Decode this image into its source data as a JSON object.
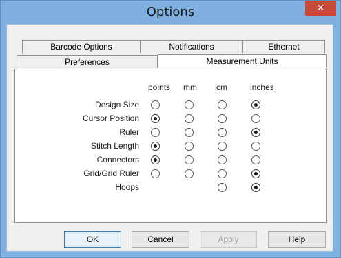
{
  "window": {
    "title": "Options",
    "close_glyph": "✕"
  },
  "tabs_back": [
    {
      "label": "Barcode Options"
    },
    {
      "label": "Notifications"
    },
    {
      "label": "Ethernet"
    }
  ],
  "tabs_front": [
    {
      "label": "Preferences"
    },
    {
      "label": "Measurement Units"
    }
  ],
  "columns": [
    {
      "label": "points"
    },
    {
      "label": "mm"
    },
    {
      "label": "cm"
    },
    {
      "label": "inches"
    }
  ],
  "rows": [
    {
      "label": "Design Size",
      "selected": "inches",
      "available": [
        "points",
        "mm",
        "cm",
        "inches"
      ]
    },
    {
      "label": "Cursor Position",
      "selected": "points",
      "available": [
        "points",
        "mm",
        "cm",
        "inches"
      ]
    },
    {
      "label": "Ruler",
      "selected": "inches",
      "available": [
        "points",
        "mm",
        "cm",
        "inches"
      ]
    },
    {
      "label": "Stitch Length",
      "selected": "points",
      "available": [
        "points",
        "mm",
        "cm",
        "inches"
      ]
    },
    {
      "label": "Connectors",
      "selected": "points",
      "available": [
        "points",
        "mm",
        "cm",
        "inches"
      ]
    },
    {
      "label": "Grid/Grid Ruler",
      "selected": "inches",
      "available": [
        "points",
        "mm",
        "cm",
        "inches"
      ]
    },
    {
      "label": "Hoops",
      "selected": "inches",
      "available": [
        "cm",
        "inches"
      ]
    }
  ],
  "buttons": {
    "ok": "OK",
    "cancel": "Cancel",
    "apply": "Apply",
    "help": "Help"
  }
}
